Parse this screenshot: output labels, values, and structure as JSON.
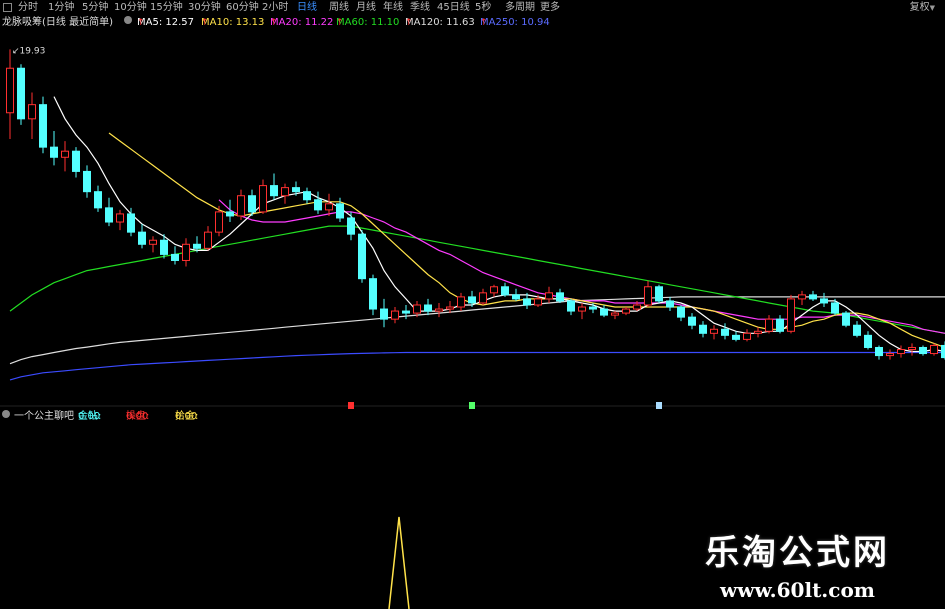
{
  "toolbar": {
    "periods": [
      "分时",
      "1分钟",
      "5分钟",
      "10分钟",
      "15分钟",
      "30分钟",
      "60分钟",
      "2小时",
      "日线",
      "周线",
      "月线",
      "年线",
      "季线",
      "45日线",
      "5秒",
      "多周期",
      "更多"
    ],
    "active_period": "日线",
    "restore_label": "复权"
  },
  "indicator_bar": {
    "title": "龙脉吸筹(日线 最近简单)",
    "ma5": "MA5: 12.57",
    "ma10": "MA10: 13.13",
    "ma20": "MA20: 11.22",
    "ma60": "MA60: 11.10",
    "ma120": "MA120: 11.63",
    "ma250": "MA250: 10.94",
    "up_arrow": "↑",
    "colors": {
      "ma5": "#ffffff",
      "ma10": "#ffe24a",
      "ma20": "#ff3cff",
      "ma60": "#22dd22",
      "ma120": "#dddddd",
      "ma250": "#3b4bff"
    }
  },
  "sub_bar": {
    "title": "一个公主聊吧",
    "v1_label": "金钻: ",
    "v1_value": "0.00",
    "v2_label": "操盘: ",
    "v2_value": "0.00",
    "v3_label": "拾金: ",
    "v3_value": "0.00"
  },
  "watermark": {
    "line1": "乐淘公式网",
    "line2": "www.60lt.com"
  },
  "chart_data": {
    "type": "candlestick",
    "high_label": "19.93",
    "colors": {
      "up": "#ff3030",
      "down": "#54ffff",
      "ma5": "#ffffff",
      "ma10": "#ffe24a",
      "ma20": "#ff3cff",
      "ma60": "#22dd22",
      "ma120": "#dddddd",
      "ma250": "#3b4bff",
      "signal": "#ffe24a"
    },
    "candles": [
      [
        16.8,
        19.93,
        15.5,
        19.0
      ],
      [
        19.0,
        19.2,
        16.2,
        16.5
      ],
      [
        16.5,
        17.8,
        15.5,
        17.2
      ],
      [
        17.2,
        17.6,
        14.8,
        15.1
      ],
      [
        15.1,
        15.9,
        14.2,
        14.6
      ],
      [
        14.6,
        15.4,
        13.9,
        14.9
      ],
      [
        14.9,
        15.1,
        13.6,
        13.9
      ],
      [
        13.9,
        14.2,
        12.6,
        12.9
      ],
      [
        12.9,
        13.2,
        11.9,
        12.1
      ],
      [
        12.1,
        12.6,
        11.2,
        11.4
      ],
      [
        11.4,
        12.0,
        11.0,
        11.8
      ],
      [
        11.8,
        12.1,
        10.7,
        10.9
      ],
      [
        10.9,
        11.3,
        10.1,
        10.3
      ],
      [
        10.3,
        10.7,
        9.9,
        10.5
      ],
      [
        10.5,
        10.8,
        9.6,
        9.8
      ],
      [
        9.8,
        10.2,
        9.3,
        9.5
      ],
      [
        9.5,
        10.6,
        9.2,
        10.3
      ],
      [
        10.3,
        10.7,
        9.9,
        10.1
      ],
      [
        10.1,
        11.2,
        10.0,
        10.9
      ],
      [
        10.9,
        12.2,
        10.7,
        11.9
      ],
      [
        11.9,
        12.5,
        11.4,
        11.7
      ],
      [
        11.7,
        13.0,
        11.5,
        12.7
      ],
      [
        12.7,
        13.0,
        11.7,
        11.9
      ],
      [
        11.9,
        13.5,
        11.8,
        13.2
      ],
      [
        13.2,
        13.8,
        12.5,
        12.7
      ],
      [
        12.7,
        13.3,
        12.3,
        13.1
      ],
      [
        13.1,
        13.4,
        12.7,
        12.9
      ],
      [
        12.9,
        13.1,
        12.3,
        12.5
      ],
      [
        12.5,
        12.9,
        11.8,
        12.0
      ],
      [
        12.0,
        12.8,
        11.7,
        12.3
      ],
      [
        12.3,
        12.6,
        11.4,
        11.6
      ],
      [
        11.6,
        11.9,
        10.5,
        10.8
      ],
      [
        10.8,
        11.0,
        8.4,
        8.6
      ],
      [
        8.6,
        8.8,
        6.8,
        7.1
      ],
      [
        7.1,
        7.6,
        6.2,
        6.6
      ],
      [
        6.6,
        7.2,
        6.4,
        7.0
      ],
      [
        7.0,
        7.3,
        6.6,
        6.9
      ],
      [
        6.9,
        7.5,
        6.7,
        7.3
      ],
      [
        7.3,
        7.6,
        6.8,
        7.0
      ],
      [
        7.0,
        7.4,
        6.7,
        7.1
      ],
      [
        7.1,
        7.5,
        6.9,
        7.2
      ],
      [
        7.2,
        7.9,
        7.0,
        7.7
      ],
      [
        7.7,
        8.0,
        7.2,
        7.4
      ],
      [
        7.4,
        8.1,
        7.3,
        7.9
      ],
      [
        7.9,
        8.3,
        7.7,
        8.2
      ],
      [
        8.2,
        8.4,
        7.7,
        7.8
      ],
      [
        7.8,
        8.1,
        7.5,
        7.6
      ],
      [
        7.6,
        7.9,
        7.1,
        7.3
      ],
      [
        7.3,
        7.8,
        7.2,
        7.6
      ],
      [
        7.6,
        8.2,
        7.4,
        7.9
      ],
      [
        7.9,
        8.1,
        7.4,
        7.5
      ],
      [
        7.5,
        7.6,
        6.8,
        7.0
      ],
      [
        7.0,
        7.4,
        6.6,
        7.2
      ],
      [
        7.2,
        7.4,
        6.9,
        7.1
      ],
      [
        7.1,
        7.3,
        6.7,
        6.8
      ],
      [
        6.8,
        7.0,
        6.6,
        6.9
      ],
      [
        6.9,
        7.2,
        6.8,
        7.1
      ],
      [
        7.1,
        7.5,
        7.0,
        7.3
      ],
      [
        7.3,
        8.5,
        7.2,
        8.2
      ],
      [
        8.2,
        8.3,
        7.4,
        7.5
      ],
      [
        7.5,
        7.7,
        7.0,
        7.2
      ],
      [
        7.2,
        7.3,
        6.5,
        6.7
      ],
      [
        6.7,
        6.9,
        6.1,
        6.3
      ],
      [
        6.3,
        6.5,
        5.7,
        5.9
      ],
      [
        5.9,
        6.3,
        5.6,
        6.1
      ],
      [
        6.1,
        6.4,
        5.6,
        5.8
      ],
      [
        5.8,
        6.0,
        5.5,
        5.6
      ],
      [
        5.6,
        6.1,
        5.5,
        5.9
      ],
      [
        5.9,
        6.2,
        5.7,
        6.0
      ],
      [
        6.0,
        6.8,
        5.9,
        6.6
      ],
      [
        6.6,
        6.8,
        5.9,
        6.0
      ],
      [
        6.0,
        7.8,
        5.9,
        7.6
      ],
      [
        7.6,
        8.0,
        7.3,
        7.8
      ],
      [
        7.8,
        8.0,
        7.5,
        7.6
      ],
      [
        7.6,
        7.9,
        7.2,
        7.4
      ],
      [
        7.4,
        7.6,
        6.8,
        6.9
      ],
      [
        6.9,
        7.0,
        6.2,
        6.3
      ],
      [
        6.3,
        6.5,
        5.7,
        5.8
      ],
      [
        5.8,
        6.0,
        5.1,
        5.2
      ],
      [
        5.2,
        5.3,
        4.6,
        4.8
      ],
      [
        4.8,
        5.1,
        4.6,
        4.9
      ],
      [
        4.9,
        5.3,
        4.7,
        5.1
      ],
      [
        5.1,
        5.4,
        4.8,
        5.2
      ],
      [
        5.2,
        5.3,
        4.8,
        4.9
      ],
      [
        4.9,
        5.4,
        4.8,
        5.3
      ],
      [
        5.3,
        5.5,
        4.6,
        4.7
      ]
    ],
    "ma5": [
      null,
      null,
      null,
      null,
      17.6,
      16.5,
      15.7,
      15.1,
      14.3,
      13.3,
      12.4,
      11.8,
      11.3,
      11.0,
      10.7,
      10.3,
      10.1,
      10.0,
      10.0,
      10.4,
      10.8,
      11.3,
      11.8,
      12.3,
      12.5,
      12.7,
      12.8,
      12.9,
      12.6,
      12.4,
      12.1,
      11.7,
      10.9,
      10.1,
      9.0,
      8.2,
      7.6,
      7.0,
      7.0,
      7.0,
      7.1,
      7.3,
      7.3,
      7.5,
      7.7,
      7.8,
      7.8,
      7.8,
      7.7,
      7.6,
      7.6,
      7.5,
      7.4,
      7.3,
      7.1,
      7.0,
      7.0,
      7.0,
      7.3,
      7.4,
      7.5,
      7.4,
      7.2,
      6.8,
      6.4,
      6.2,
      6.0,
      5.9,
      5.9,
      6.0,
      6.0,
      6.4,
      6.8,
      7.2,
      7.5,
      7.5,
      7.2,
      6.8,
      6.3,
      5.8,
      5.4,
      5.1,
      5.0,
      5.0,
      5.1,
      5.0
    ],
    "ma10": [
      null,
      null,
      null,
      null,
      null,
      null,
      null,
      null,
      null,
      15.8,
      15.4,
      15.0,
      14.6,
      14.2,
      13.8,
      13.4,
      13.0,
      12.6,
      12.3,
      12.0,
      11.8,
      11.7,
      11.8,
      11.9,
      12.0,
      12.1,
      12.2,
      12.3,
      12.4,
      12.4,
      12.4,
      12.2,
      11.8,
      11.3,
      10.8,
      10.3,
      9.8,
      9.3,
      8.8,
      8.4,
      7.9,
      7.6,
      7.4,
      7.3,
      7.4,
      7.5,
      7.5,
      7.6,
      7.6,
      7.6,
      7.6,
      7.6,
      7.5,
      7.4,
      7.3,
      7.2,
      7.2,
      7.2,
      7.2,
      7.2,
      7.2,
      7.2,
      7.2,
      7.1,
      7.0,
      6.8,
      6.6,
      6.4,
      6.2,
      6.1,
      6.1,
      6.2,
      6.3,
      6.5,
      6.6,
      6.8,
      6.9,
      6.9,
      6.8,
      6.6,
      6.4,
      6.1,
      5.8,
      5.6,
      5.4,
      5.2
    ],
    "ma20": [
      null,
      null,
      null,
      null,
      null,
      null,
      null,
      null,
      null,
      null,
      null,
      null,
      null,
      null,
      null,
      null,
      null,
      null,
      null,
      12.5,
      12.0,
      11.7,
      11.5,
      11.4,
      11.4,
      11.4,
      11.5,
      11.6,
      11.7,
      11.8,
      11.9,
      11.9,
      11.8,
      11.6,
      11.4,
      11.1,
      10.9,
      10.6,
      10.3,
      10.0,
      9.8,
      9.5,
      9.2,
      8.9,
      8.7,
      8.5,
      8.3,
      8.1,
      7.9,
      7.8,
      7.7,
      7.6,
      7.5,
      7.5,
      7.5,
      7.4,
      7.4,
      7.4,
      7.4,
      7.4,
      7.4,
      7.3,
      7.2,
      7.1,
      7.0,
      6.9,
      6.8,
      6.7,
      6.6,
      6.6,
      6.6,
      6.6,
      6.7,
      6.7,
      6.7,
      6.8,
      6.8,
      6.8,
      6.7,
      6.6,
      6.5,
      6.4,
      6.3,
      6.1,
      6.0,
      5.9
    ],
    "ma60": [
      7.0,
      7.4,
      7.8,
      8.1,
      8.4,
      8.6,
      8.8,
      9.0,
      9.1,
      9.2,
      9.3,
      9.4,
      9.5,
      9.6,
      9.7,
      9.8,
      9.9,
      10.0,
      10.1,
      10.2,
      10.3,
      10.4,
      10.5,
      10.6,
      10.7,
      10.8,
      10.9,
      11.0,
      11.1,
      11.2,
      11.2,
      11.2,
      11.1,
      11.0,
      10.9,
      10.8,
      10.7,
      10.6,
      10.5,
      10.4,
      10.3,
      10.2,
      10.1,
      10.0,
      9.9,
      9.8,
      9.7,
      9.6,
      9.5,
      9.4,
      9.3,
      9.2,
      9.1,
      9.0,
      8.9,
      8.8,
      8.7,
      8.6,
      8.5,
      8.4,
      8.3,
      8.2,
      8.1,
      8.0,
      7.9,
      7.8,
      7.7,
      7.6,
      7.5,
      7.4,
      7.3,
      7.2,
      7.1,
      7.0,
      6.95,
      6.9,
      6.8,
      6.7,
      6.6,
      6.5,
      6.4,
      6.3,
      6.2,
      6.1,
      6.0,
      5.9
    ],
    "ma120": [
      4.4,
      4.6,
      4.75,
      4.85,
      4.95,
      5.05,
      5.15,
      5.22,
      5.3,
      5.38,
      5.45,
      5.5,
      5.55,
      5.6,
      5.65,
      5.7,
      5.75,
      5.8,
      5.85,
      5.9,
      5.95,
      6.0,
      6.05,
      6.1,
      6.15,
      6.2,
      6.25,
      6.3,
      6.35,
      6.4,
      6.45,
      6.5,
      6.55,
      6.6,
      6.65,
      6.7,
      6.75,
      6.8,
      6.85,
      6.9,
      6.95,
      7.0,
      7.05,
      7.1,
      7.15,
      7.2,
      7.25,
      7.3,
      7.35,
      7.4,
      7.45,
      7.5,
      7.52,
      7.54,
      7.56,
      7.58,
      7.6,
      7.62,
      7.64,
      7.66,
      7.68,
      7.7,
      7.7,
      7.7,
      7.7,
      7.7,
      7.7,
      7.7,
      7.7,
      7.7,
      7.7,
      7.7,
      7.7,
      7.7,
      7.7,
      7.7,
      7.7,
      7.7,
      7.7,
      7.7,
      7.7,
      7.7,
      7.7,
      7.7,
      7.7,
      7.7
    ],
    "ma250": [
      3.6,
      3.75,
      3.85,
      3.95,
      4.0,
      4.05,
      4.1,
      4.15,
      4.2,
      4.25,
      4.3,
      4.35,
      4.38,
      4.41,
      4.44,
      4.47,
      4.5,
      4.53,
      4.56,
      4.59,
      4.62,
      4.65,
      4.68,
      4.71,
      4.74,
      4.77,
      4.8,
      4.82,
      4.84,
      4.86,
      4.88,
      4.9,
      4.91,
      4.92,
      4.93,
      4.94,
      4.95,
      4.95,
      4.95,
      4.95,
      4.95,
      4.95,
      4.95,
      4.95,
      4.95,
      4.95,
      4.95,
      4.95,
      4.95,
      4.95,
      4.95,
      4.95,
      4.95,
      4.95,
      4.95,
      4.95,
      4.95,
      4.95,
      4.95,
      4.95,
      4.95,
      4.95,
      4.95,
      4.95,
      4.95,
      4.95,
      4.95,
      4.95,
      4.95,
      4.95,
      4.95,
      4.95,
      4.95,
      4.95,
      4.95,
      4.95,
      4.95,
      4.95,
      4.95,
      4.95,
      4.95,
      4.95,
      4.95,
      4.95,
      4.95,
      4.95
    ],
    "markers": [
      {
        "i": 31,
        "color": "#ff3030"
      },
      {
        "i": 42,
        "color": "#54ff6a"
      },
      {
        "i": 59,
        "color": "#aaddff"
      }
    ],
    "signal_spike_index": 30
  }
}
